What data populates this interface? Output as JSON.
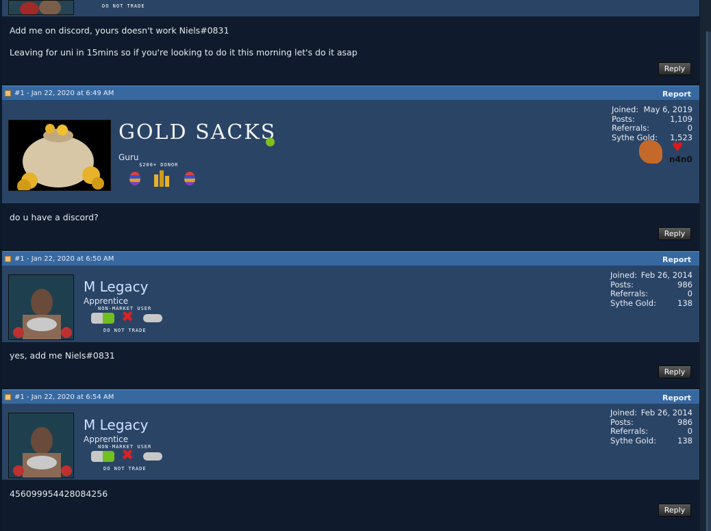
{
  "top_partial": {
    "tag": "DO NOT TRADE",
    "lines": [
      "Add me on discord, yours doesn't work Niels#0831",
      "Leaving for uni in 15mins so if you're looking to do it this morning let's do it asap"
    ],
    "reply_label": "Reply"
  },
  "posts": [
    {
      "header": "#1 - Jan 22, 2020 at 6:49 AM",
      "report": "Report",
      "username": "GOLD SACKS",
      "rank": "Guru",
      "badge_label": "$200+ DONOR",
      "stats": [
        [
          "Joined:",
          "May 6, 2019"
        ],
        [
          "Posts:",
          "1,109"
        ],
        [
          "Referrals:",
          "0"
        ],
        [
          "Sythe Gold:",
          "1,523"
        ]
      ],
      "side_badge": "n4n0",
      "message": "do u have a discord?",
      "reply_label": "Reply"
    },
    {
      "header": "#1 - Jan 22, 2020 at 6:50 AM",
      "report": "Report",
      "username": "M Legacy",
      "rank": "Apprentice",
      "tag_top": "NON-MARKET USER",
      "tag_bottom": "DO NOT TRADE",
      "stats": [
        [
          "Joined:",
          "Feb 26, 2014"
        ],
        [
          "Posts:",
          "986"
        ],
        [
          "Referrals:",
          "0"
        ],
        [
          "Sythe Gold:",
          "138"
        ]
      ],
      "message": "yes, add me Niels#0831",
      "reply_label": "Reply"
    },
    {
      "header": "#1 - Jan 22, 2020 at 6:54 AM",
      "report": "Report",
      "username": "M Legacy",
      "rank": "Apprentice",
      "tag_top": "NON-MARKET USER",
      "tag_bottom": "DO NOT TRADE",
      "stats": [
        [
          "Joined:",
          "Feb 26, 2014"
        ],
        [
          "Posts:",
          "986"
        ],
        [
          "Referrals:",
          "0"
        ],
        [
          "Sythe Gold:",
          "138"
        ]
      ],
      "message": "456099954428084256",
      "reply_label": "Reply"
    }
  ]
}
